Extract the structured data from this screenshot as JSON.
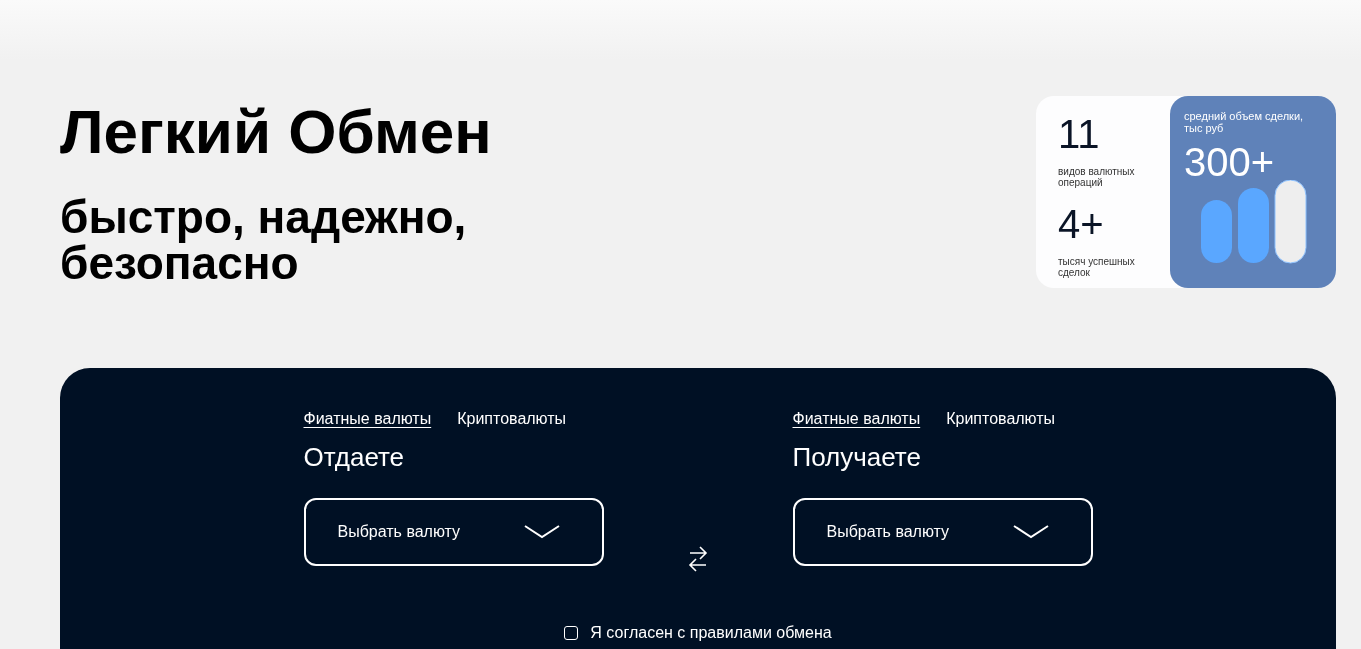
{
  "hero": {
    "title": "Легкий Обмен",
    "subtitle": "быстро, надежно, безопасно"
  },
  "stats": {
    "items": [
      {
        "value": "11",
        "caption": "видов валютных операций"
      },
      {
        "value": "4+",
        "caption": "тысяч успешных сделок"
      }
    ],
    "highlight": {
      "caption": "средний объем сделки, тыс руб",
      "value": "300+"
    }
  },
  "exchange": {
    "sides": [
      {
        "tabs": [
          {
            "label": "Фиатные валюты",
            "selected": true
          },
          {
            "label": "Криптовалюты",
            "selected": false
          }
        ],
        "heading": "Отдаете",
        "select": {
          "placeholder": "Выбрать валюту"
        }
      },
      {
        "tabs": [
          {
            "label": "Фиатные валюты",
            "selected": true
          },
          {
            "label": "Криптовалюты",
            "selected": false
          }
        ],
        "heading": "Получаете",
        "select": {
          "placeholder": "Выбрать валюту"
        }
      }
    ],
    "agreement": {
      "label": "Я согласен с правилами обмена",
      "checked": false
    }
  }
}
